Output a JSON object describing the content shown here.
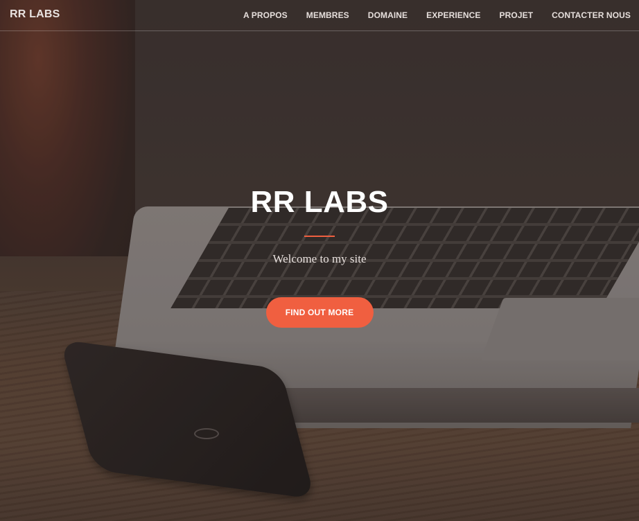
{
  "navbar": {
    "brand": "RR LABS",
    "links": [
      {
        "label": "A PROPOS"
      },
      {
        "label": "MEMBRES"
      },
      {
        "label": "DOMAINE"
      },
      {
        "label": "EXPERIENCE"
      },
      {
        "label": "PROJET"
      },
      {
        "label": "CONTACTER NOUS"
      }
    ]
  },
  "hero": {
    "title": "RR LABS",
    "subtitle": "Welcome to my site",
    "cta_label": "FIND OUT MORE"
  },
  "colors": {
    "accent": "#f05f40",
    "text_light": "#ffffff"
  }
}
